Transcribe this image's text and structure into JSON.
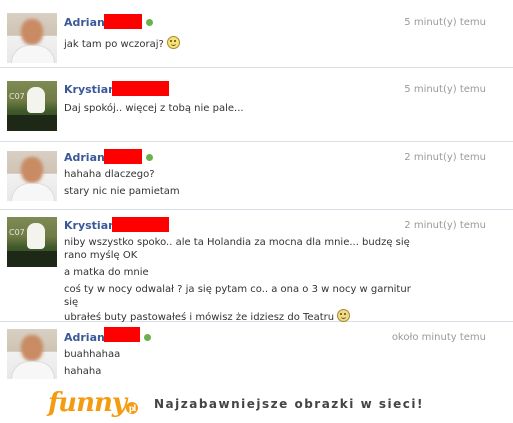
{
  "messages": [
    {
      "author": "Adrian",
      "time": "5 minut(y) temu",
      "online": true,
      "avatar": "person",
      "lines": [
        "jak tam po wczoraj?"
      ],
      "emoji": "smile-icon"
    },
    {
      "author": "Krystian",
      "time": "5 minut(y) temu",
      "online": false,
      "avatar": "photo",
      "avatar_text": "C07",
      "lines": [
        "Daj spokój.. więcej z tobą nie pale..."
      ]
    },
    {
      "author": "Adrian",
      "time": "2 minut(y) temu",
      "online": true,
      "avatar": "person",
      "lines": [
        "hahaha dlaczego?",
        "stary nic nie pamietam"
      ]
    },
    {
      "author": "Krystian",
      "time": "2 minut(y) temu",
      "online": false,
      "avatar": "photo",
      "avatar_text": "C07",
      "lines": [
        "niby wszystko spoko.. ale ta Holandia za mocna dla mnie... budzę się",
        "rano myślę OK",
        "a matka do mnie",
        "coś ty w nocy odwalał ? ja się pytam co.. a ona o 3 w nocy w garnitur się",
        "ubrałeś buty pastowałeś i mówisz że idziesz do Teatru"
      ],
      "emoji": "sad-icon"
    },
    {
      "author": "Adrian",
      "time": "około minuty temu",
      "online": true,
      "avatar": "person",
      "lines": [
        "buahhahaa",
        "hahaha"
      ]
    }
  ],
  "footer": {
    "logo": "funny",
    "logo_badge": "pl",
    "slogan": "Najzabawniejsze obrazki w sieci!"
  },
  "colors": {
    "name": "#3b5998",
    "redaction": "#ff0000",
    "online": "#6ab04c",
    "logo": "#f39c12"
  }
}
